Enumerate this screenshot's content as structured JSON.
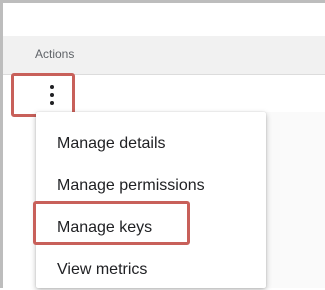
{
  "table": {
    "header": {
      "actions_label": "Actions"
    },
    "row": {
      "more_icon": "more-vert-icon"
    }
  },
  "menu": {
    "items": [
      {
        "label": "Manage details"
      },
      {
        "label": "Manage permissions"
      },
      {
        "label": "Manage keys",
        "highlighted": true
      },
      {
        "label": "View metrics"
      }
    ]
  },
  "colors": {
    "highlight": "#c8605a",
    "header_bg": "#f1f1f1",
    "text": "#202124",
    "header_text": "#5f6368"
  }
}
